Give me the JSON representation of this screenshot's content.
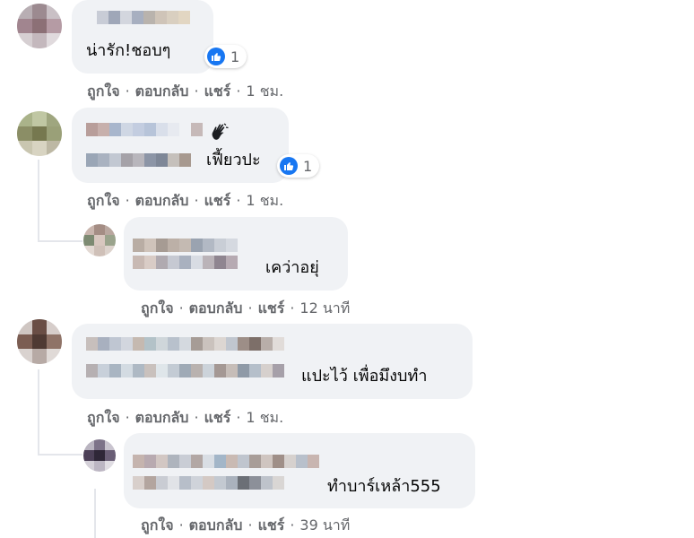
{
  "comments": [
    {
      "text": "น่ารัก!ชอบๆ",
      "likes": "1",
      "actions": {
        "like": "ถูกใจ",
        "reply": "ตอบกลับ",
        "share": "แชร์",
        "time": "1 ชม."
      }
    },
    {
      "text": "เฟี้ยวปะ",
      "likes": "1",
      "actions": {
        "like": "ถูกใจ",
        "reply": "ตอบกลับ",
        "share": "แชร์",
        "time": "1 ชม."
      }
    },
    {
      "text": "เคว่าอยุ่",
      "actions": {
        "like": "ถูกใจ",
        "reply": "ตอบกลับ",
        "share": "แชร์",
        "time": "12 นาที"
      }
    },
    {
      "text": "แปะไว้ เพื่อมึงบทำ",
      "actions": {
        "like": "ถูกใจ",
        "reply": "ตอบกลับ",
        "share": "แชร์",
        "time": "1 ชม."
      }
    },
    {
      "text": "ทำบาร์เหล้า555",
      "actions": {
        "like": "ถูกใจ",
        "reply": "ตอบกลับ",
        "share": "แชร์",
        "time": "39 นาที"
      }
    }
  ],
  "separator": "·",
  "icons": {
    "like": "like-thumb-icon",
    "wave": "waving-hand-icon"
  },
  "colors": {
    "bubble": "#f0f2f5",
    "meta": "#65676b",
    "like_blue": "#1877f2"
  }
}
